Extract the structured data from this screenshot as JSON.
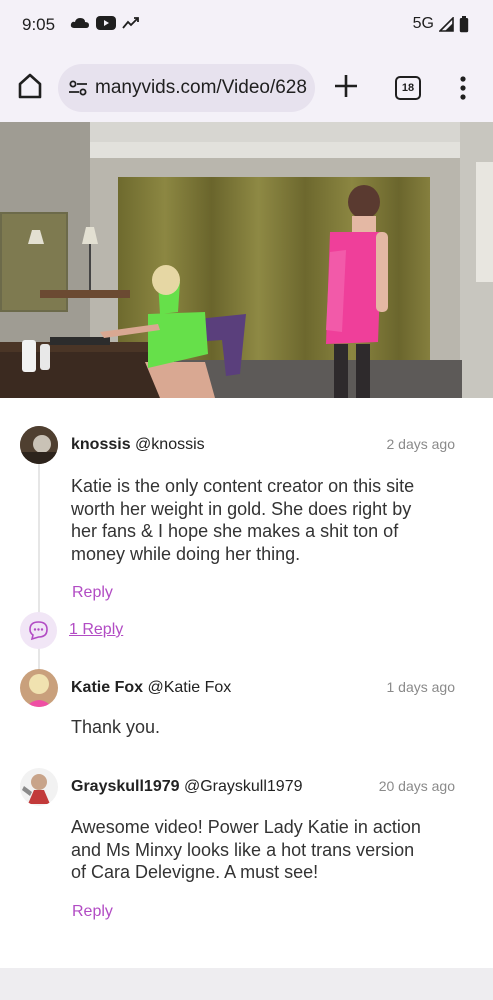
{
  "status_bar": {
    "time": "9:05",
    "network": "5G"
  },
  "browser": {
    "url": "manyvids.com/Video/628",
    "tab_count": "18"
  },
  "comments": [
    {
      "name": "knossis",
      "handle": "@knossis",
      "time": "2 days ago",
      "lines": [
        "Katie is the only content creator on this site",
        "worth her weight in gold. She does right by",
        "her fans & I hope she makes a shit ton of",
        "money while doing her thing."
      ],
      "reply_label": "Reply",
      "replies_label": "1 Reply"
    },
    {
      "name": "Katie Fox",
      "handle": "@Katie Fox",
      "time": "1 days ago",
      "lines": [
        "Thank you."
      ]
    },
    {
      "name": "Grayskull1979",
      "handle": "@Grayskull1979",
      "time": "20 days ago",
      "lines": [
        "Awesome video! Power Lady Katie in action",
        "and Ms Minxy looks like a hot trans version",
        "of Cara Delevigne. A must see!"
      ],
      "reply_label": "Reply"
    }
  ]
}
